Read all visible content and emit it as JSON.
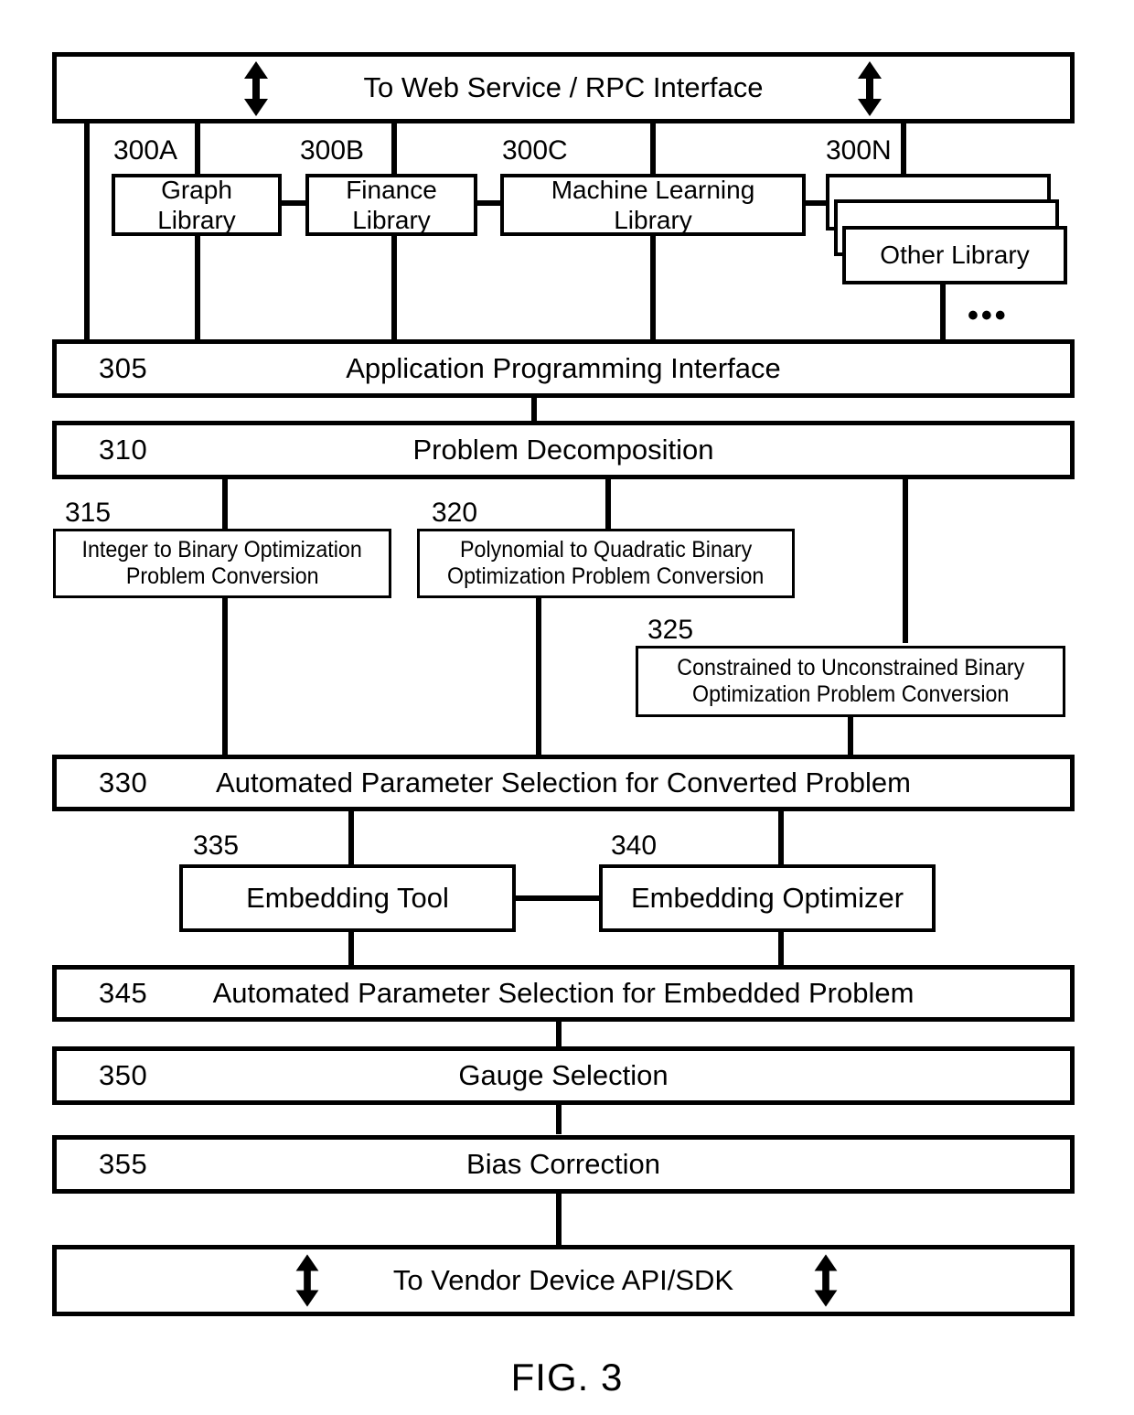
{
  "figure": {
    "label": "FIG. 3"
  },
  "top_interface": {
    "title": "To Web Service / RPC Interface",
    "left_arrow_icon": "double-headed-vertical-arrow-icon",
    "right_arrow_icon": "double-headed-vertical-arrow-icon"
  },
  "libraries": {
    "items": [
      {
        "ref": "300A",
        "label_line1": "Graph",
        "label_line2": "Library"
      },
      {
        "ref": "300B",
        "label_line1": "Finance",
        "label_line2": "Library"
      },
      {
        "ref": "300C",
        "label_line1": "Machine Learning",
        "label_line2": "Library"
      },
      {
        "ref": "300N",
        "label_line1": "Other Library",
        "label_line2": ""
      }
    ],
    "stack_labels": [
      "Other Library",
      "Other Library",
      "Other Library"
    ],
    "ellipsis": "•••"
  },
  "stages": {
    "api": {
      "ref": "305",
      "title": "Application Programming Interface"
    },
    "decomposition": {
      "ref": "310",
      "title": "Problem Decomposition"
    },
    "param_converted": {
      "ref": "330",
      "title": "Automated Parameter Selection for Converted Problem"
    },
    "param_embedded": {
      "ref": "345",
      "title": "Automated Parameter Selection for Embedded Problem"
    },
    "gauge": {
      "ref": "350",
      "title": "Gauge Selection"
    },
    "bias": {
      "ref": "355",
      "title": "Bias Correction"
    }
  },
  "conversions": {
    "integer_to_binary": {
      "ref": "315",
      "line1": "Integer to  Binary Optimization",
      "line2": "Problem Conversion"
    },
    "polynomial_to_quadratic": {
      "ref": "320",
      "line1": "Polynomial to Quadratic  Binary",
      "line2": "Optimization Problem Conversion"
    },
    "constrained_to_unconstrained": {
      "ref": "325",
      "line1": "Constrained to Unconstrained Binary",
      "line2": "Optimization Problem Conversion"
    }
  },
  "embedding": {
    "tool": {
      "ref": "335",
      "title": "Embedding Tool"
    },
    "optimizer": {
      "ref": "340",
      "title": "Embedding Optimizer"
    }
  },
  "bottom_interface": {
    "title": "To Vendor Device API/SDK",
    "left_arrow_icon": "double-headed-vertical-arrow-icon",
    "right_arrow_icon": "double-headed-vertical-arrow-icon"
  }
}
